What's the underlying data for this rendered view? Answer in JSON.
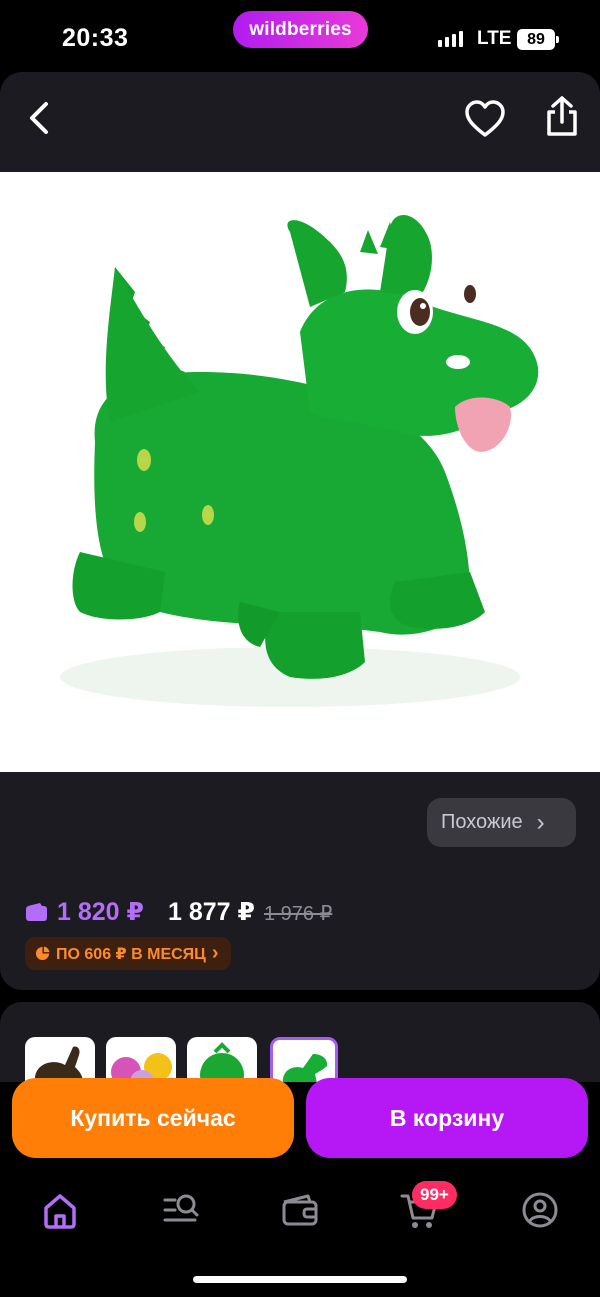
{
  "status_bar": {
    "time": "20:33",
    "brand": "wildberries",
    "network": "LTE",
    "battery": "89"
  },
  "header": {
    "back_icon": "chevron-left-icon",
    "favorite_icon": "heart-icon",
    "share_icon": "share-icon"
  },
  "product": {
    "image_description_icon": "green-inflatable-dragon-hopper-icon"
  },
  "similar": {
    "label": "Похожие",
    "chevron": "›"
  },
  "prices": {
    "wallet_price": "1 820 ₽",
    "card_price": "1 877 ₽",
    "old_price": "1 976 ₽",
    "wallet_icon": "wallet-icon"
  },
  "installment": {
    "label": "ПО 606 ₽ В МЕСЯЦ",
    "chevron": "›",
    "icon": "pie-chart-icon"
  },
  "thumbnails": [
    {
      "name": "thumb-horse"
    },
    {
      "name": "thumb-animals"
    },
    {
      "name": "thumb-ball"
    },
    {
      "name": "thumb-dragon",
      "selected": true
    }
  ],
  "actions": {
    "buy_now": "Купить сейчас",
    "add_to_cart": "В корзину"
  },
  "bottom_nav": {
    "items": [
      "home-icon",
      "catalog-search-icon",
      "wallet-icon",
      "cart-icon",
      "profile-icon"
    ],
    "cart_badge": "99+"
  },
  "colors": {
    "accent_purple": "#b518f4",
    "accent_orange": "#ff7e07",
    "badge_red": "#ff2c64",
    "background_dark": "#1c1b21"
  }
}
